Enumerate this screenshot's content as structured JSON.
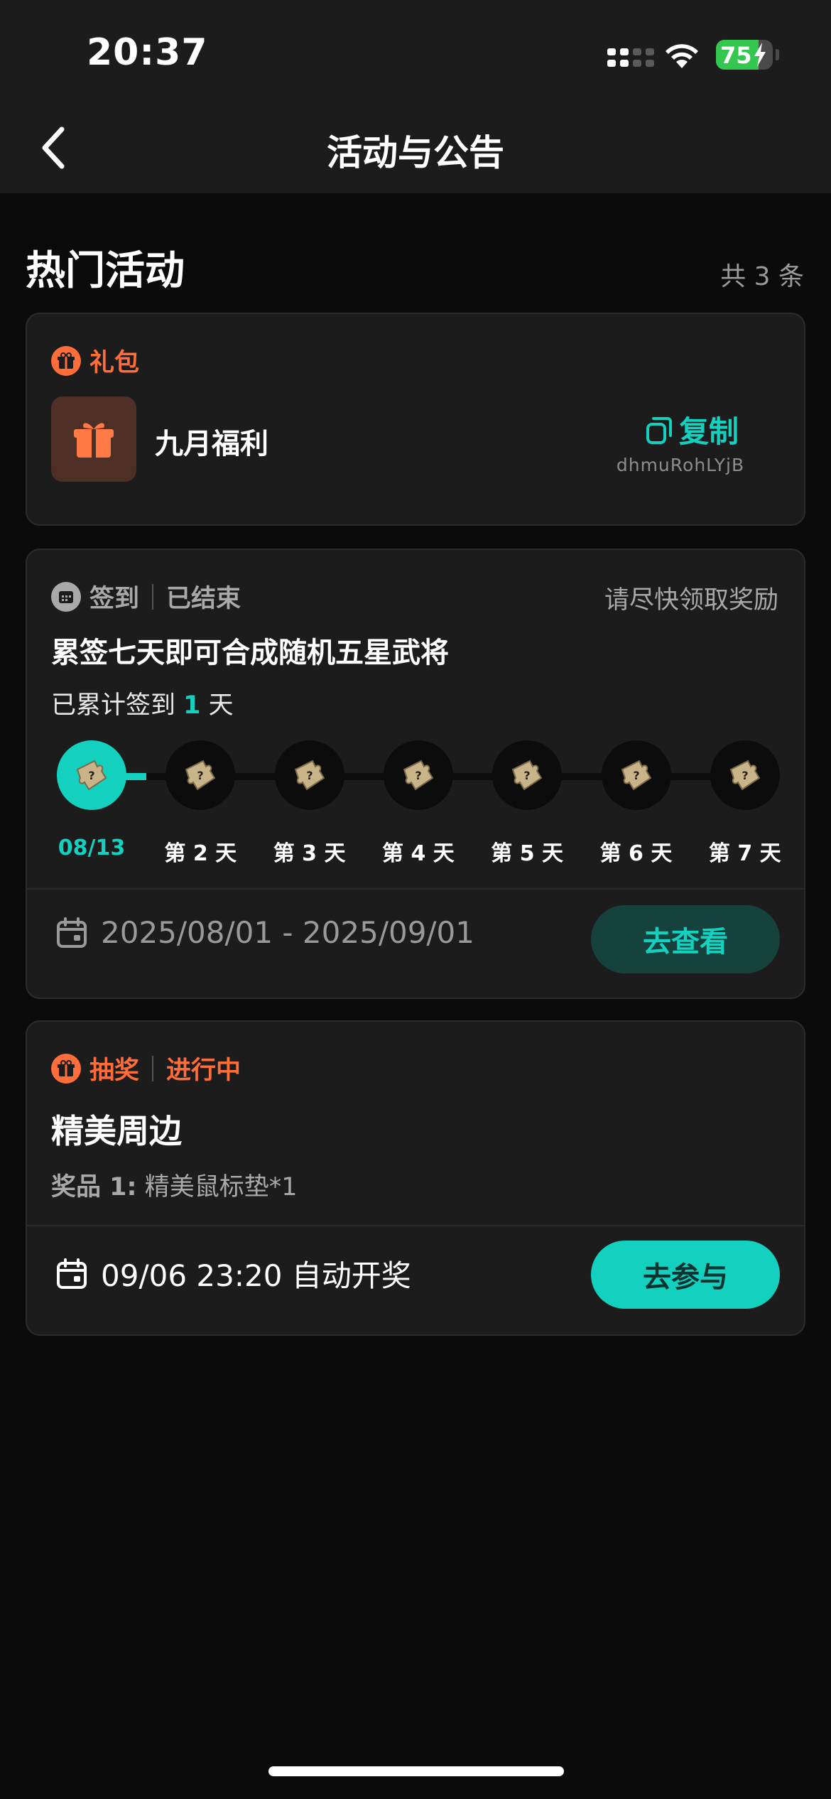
{
  "status_bar": {
    "time": "20:37",
    "battery": "75",
    "battery_level": 0.75
  },
  "nav": {
    "title": "活动与公告",
    "back_icon": "chevron-left-icon"
  },
  "section": {
    "title": "热门活动",
    "count": "共 3 条"
  },
  "colors": {
    "accent": "#14d1bf",
    "orange": "#ff6d3a",
    "card": "#1c1c1c",
    "bg": "#0b0b0b"
  },
  "gift_card": {
    "tag": "礼包",
    "name": "九月福利",
    "copy_label": "复制",
    "code": "dhmuRohLYjB"
  },
  "checkin_card": {
    "tag": "签到",
    "status": "已结束",
    "note": "请尽快领取奖励",
    "headline": "累签七天即可合成随机五星武将",
    "signed_prefix": "已累计签到",
    "signed_count": "1",
    "signed_suffix": "天",
    "days": [
      {
        "label": "08/13",
        "done": true
      },
      {
        "label": "第 2 天",
        "done": false
      },
      {
        "label": "第 3 天",
        "done": false
      },
      {
        "label": "第 4 天",
        "done": false
      },
      {
        "label": "第 5 天",
        "done": false
      },
      {
        "label": "第 6 天",
        "done": false
      },
      {
        "label": "第 7 天",
        "done": false
      }
    ],
    "date_range": "2025/08/01 - 2025/09/01",
    "button": "去查看"
  },
  "lottery_card": {
    "tag": "抽奖",
    "status": "进行中",
    "headline": "精美周边",
    "prize_label": "奖品 1:",
    "prize_value": "精美鼠标垫*1",
    "draw_time": "09/06 23:20 自动开奖",
    "button": "去参与"
  }
}
